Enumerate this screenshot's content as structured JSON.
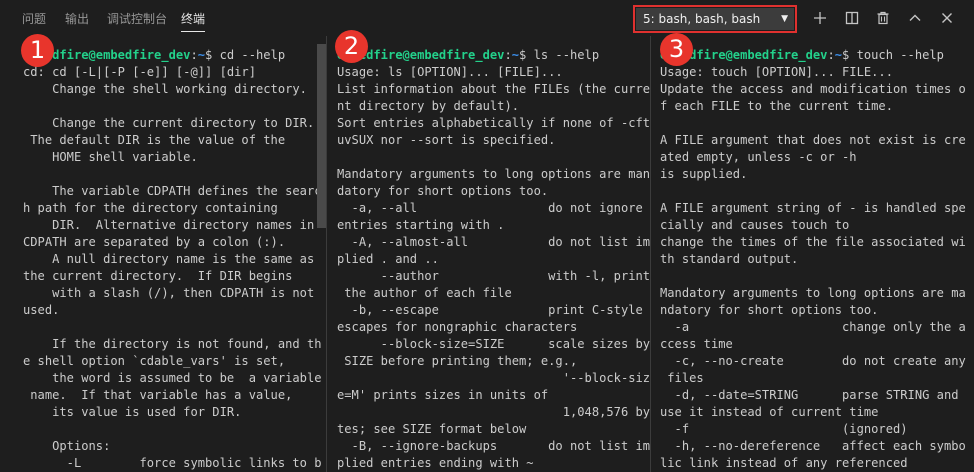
{
  "panel": {
    "tabs": [
      {
        "label": "问题"
      },
      {
        "label": "输出"
      },
      {
        "label": "调试控制台"
      },
      {
        "label": "终端"
      }
    ],
    "terminal_select": "5: bash, bash, bash",
    "actions": [
      "plus-icon",
      "split-icon",
      "trash-icon",
      "chevron-up-icon",
      "close-icon"
    ]
  },
  "badges": [
    "1",
    "2",
    "3"
  ],
  "terminals": [
    {
      "prompt_user": "embedfire@embedfire_dev",
      "prompt_path": "~",
      "command": "cd --help",
      "lines": [
        "cd: cd [-L|[-P [-e]] [-@]] [dir]",
        "    Change the shell working directory.",
        "",
        "    Change the current directory to DIR.",
        " The default DIR is the value of the",
        "    HOME shell variable.",
        "",
        "    The variable CDPATH defines the searc",
        "h path for the directory containing",
        "    DIR.  Alternative directory names in",
        "CDPATH are separated by a colon (:).",
        "    A null directory name is the same as",
        "the current directory.  If DIR begins",
        "    with a slash (/), then CDPATH is not",
        "used.",
        "",
        "    If the directory is not found, and th",
        "e shell option `cdable_vars' is set,",
        "    the word is assumed to be  a variable",
        " name.  If that variable has a value,",
        "    its value is used for DIR.",
        "",
        "    Options:",
        "      -L        force symbolic links to b"
      ]
    },
    {
      "prompt_user": "embedfire@embedfire_dev",
      "prompt_path": "~",
      "command": "ls --help",
      "lines": [
        "Usage: ls [OPTION]... [FILE]...",
        "List information about the FILEs (the curre",
        "nt directory by default).",
        "Sort entries alphabetically if none of -cft",
        "uvSUX nor --sort is specified.",
        "",
        "Mandatory arguments to long options are man",
        "datory for short options too.",
        "  -a, --all                  do not ignore",
        "entries starting with .",
        "  -A, --almost-all           do not list im",
        "plied . and ..",
        "      --author               with -l, print",
        " the author of each file",
        "  -b, --escape               print C-style",
        "escapes for nongraphic characters",
        "      --block-size=SIZE      scale sizes by",
        " SIZE before printing them; e.g.,",
        "                               '--block-siz",
        "e=M' prints sizes in units of",
        "                               1,048,576 by",
        "tes; see SIZE format below",
        "  -B, --ignore-backups       do not list im",
        "plied entries ending with ~"
      ]
    },
    {
      "prompt_user": "embedfire@embedfire_dev",
      "prompt_path": "~",
      "command": "touch --help",
      "lines": [
        "Usage: touch [OPTION]... FILE...",
        "Update the access and modification times o",
        "f each FILE to the current time.",
        "",
        "A FILE argument that does not exist is cre",
        "ated empty, unless -c or -h",
        "is supplied.",
        "",
        "A FILE argument string of - is handled spe",
        "cially and causes touch to",
        "change the times of the file associated wi",
        "th standard output.",
        "",
        "Mandatory arguments to long options are ma",
        "ndatory for short options too.",
        "  -a                     change only the a",
        "ccess time",
        "  -c, --no-create        do not create any",
        " files",
        "  -d, --date=STRING      parse STRING and",
        "use it instead of current time",
        "  -f                     (ignored)",
        "  -h, --no-dereference   affect each symbo",
        "lic link instead of any referenced"
      ]
    }
  ]
}
